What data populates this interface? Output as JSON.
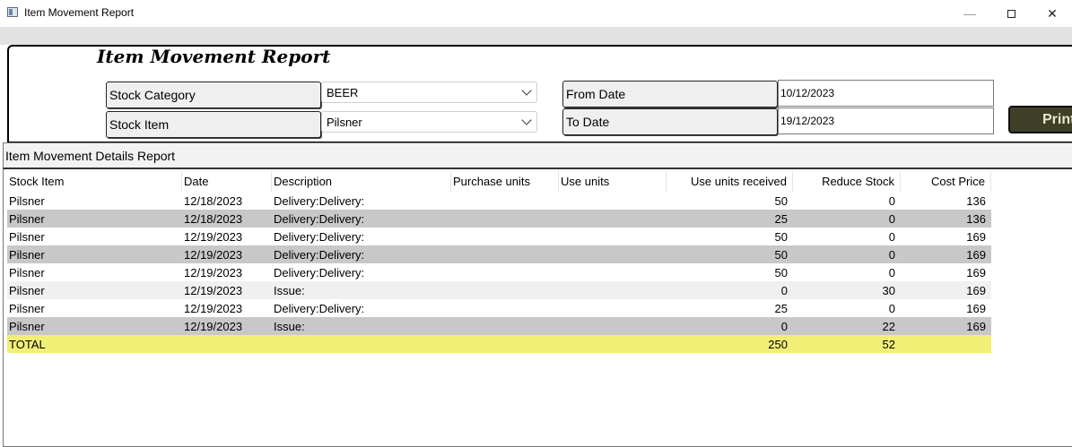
{
  "window": {
    "title": "Item Movement Report"
  },
  "report": {
    "title": "Item Movement Report"
  },
  "filters": {
    "stock_category_label": "Stock Category",
    "stock_category_value": "BEER",
    "stock_item_label": "Stock Item",
    "stock_item_value": "Pilsner",
    "from_date_label": "From Date",
    "from_date_value": "10/12/2023",
    "to_date_label": "To Date",
    "to_date_value": "19/12/2023",
    "print_label": "Print"
  },
  "details": {
    "header": "Item Movement Details Report",
    "columns": [
      "Stock Item",
      "Date",
      "Description",
      "Purchase units",
      "Use units",
      "Use units received",
      "Reduce Stock",
      "Cost Price"
    ],
    "rows": [
      [
        "Pilsner",
        "12/18/2023",
        "Delivery:Delivery:",
        "",
        "",
        "50",
        "0",
        "136"
      ],
      [
        "Pilsner",
        "12/18/2023",
        "Delivery:Delivery:",
        "",
        "",
        "25",
        "0",
        "136"
      ],
      [
        "Pilsner",
        "12/19/2023",
        "Delivery:Delivery:",
        "",
        "",
        "50",
        "0",
        "169"
      ],
      [
        "Pilsner",
        "12/19/2023",
        "Delivery:Delivery:",
        "",
        "",
        "50",
        "0",
        "169"
      ],
      [
        "Pilsner",
        "12/19/2023",
        "Delivery:Delivery:",
        "",
        "",
        "50",
        "0",
        "169"
      ],
      [
        "Pilsner",
        "12/19/2023",
        "Issue:",
        "",
        "",
        "0",
        "30",
        "169"
      ],
      [
        "Pilsner",
        "12/19/2023",
        "Delivery:Delivery:",
        "",
        "",
        "25",
        "0",
        "169"
      ],
      [
        "Pilsner",
        "12/19/2023",
        "Issue:",
        "",
        "",
        "0",
        "22",
        "169"
      ]
    ],
    "total": [
      "TOTAL",
      "",
      "",
      "",
      "",
      "250",
      "52",
      ""
    ]
  },
  "colors": {
    "row_gray": "#c8c8c8",
    "row_light": "#f0f0f0",
    "total_highlight": "#f1ef76",
    "print_button": "#3f3f28"
  }
}
